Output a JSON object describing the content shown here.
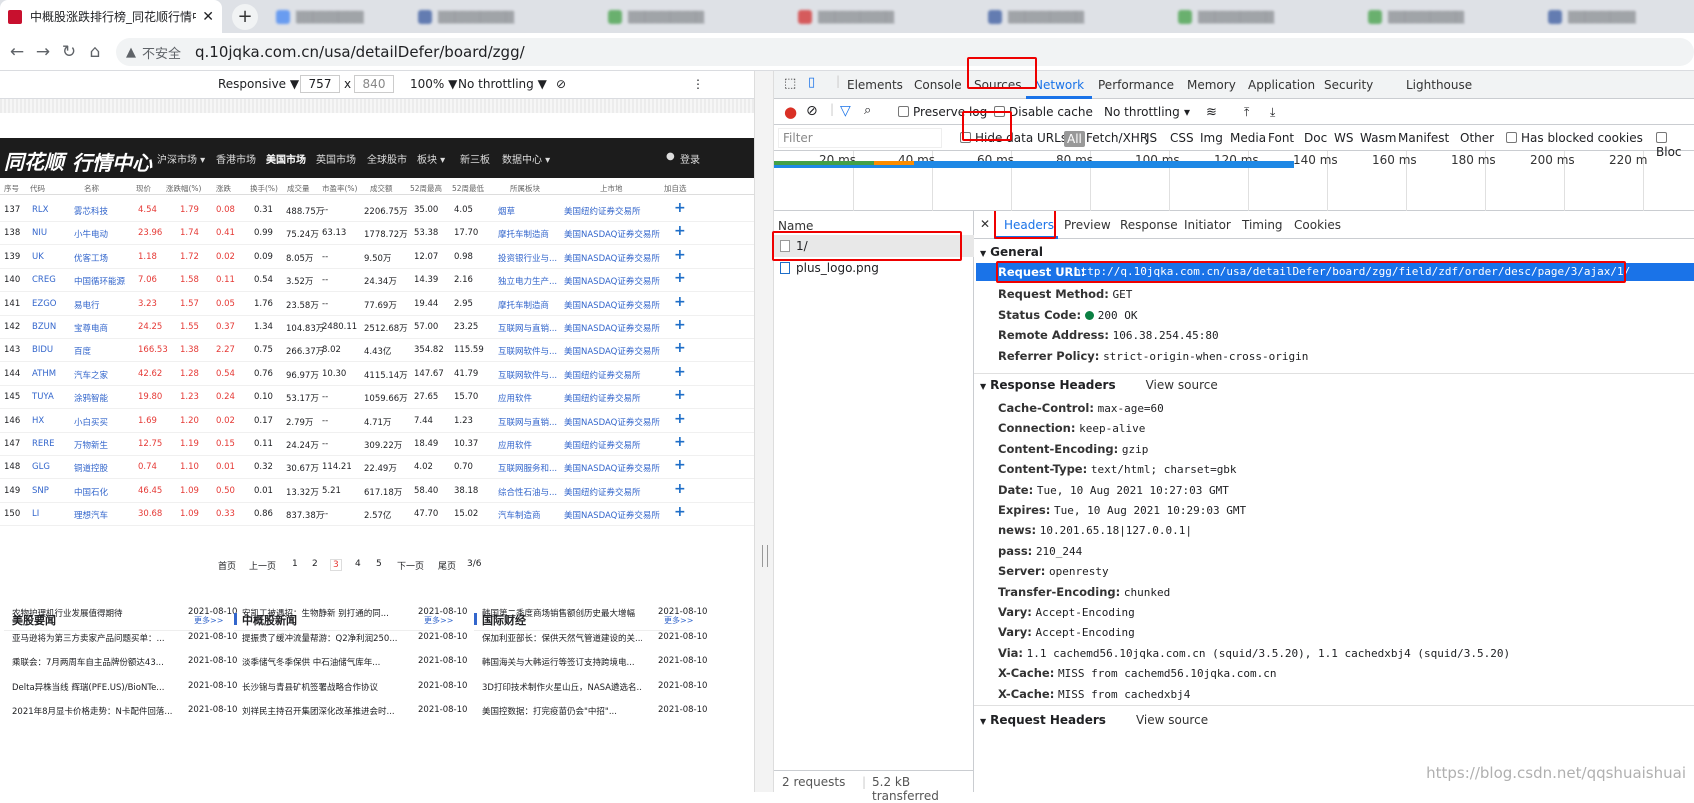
{
  "browser": {
    "active_tab_title": "中概股涨跌排行榜_同花顺行情中",
    "address_insecure": "不安全",
    "url": "q.10jqka.com.cn/usa/detailDefer/board/zgg/"
  },
  "device_toolbar": {
    "mode": "Responsive ▼",
    "width": "757",
    "times": "x",
    "height": "840",
    "zoom": "100% ▼",
    "throttle": "No throttling ▼"
  },
  "site": {
    "logo": "同花顺",
    "logo_sub": "行情中心",
    "nav": [
      "沪深市场 ▾",
      "香港市场",
      "美国市场",
      "英国市场",
      "全球股市",
      "板块 ▾",
      "新三板",
      "数据中心 ▾"
    ],
    "login": "登录",
    "columns": [
      "序号",
      "代码",
      "名称",
      "现价",
      "涨跌幅(%)",
      "涨跌",
      "换手(%)",
      "成交量",
      "市盈率(%)",
      "成交额",
      "52周最高",
      "52周最低",
      "所属板块",
      "上市地",
      "加自选"
    ],
    "rows": [
      [
        "137",
        "RLX",
        "雾芯科技",
        "4.54",
        "1.79",
        "0.08",
        "0.31",
        "488.75万",
        "--",
        "2206.75万",
        "35.00",
        "4.05",
        "烟草",
        "美国纽约证券交易所"
      ],
      [
        "138",
        "NIU",
        "小牛电动",
        "23.96",
        "1.74",
        "0.41",
        "0.99",
        "75.24万",
        "63.13",
        "1778.72万",
        "53.38",
        "17.70",
        "摩托车制造商",
        "美国NASDAQ证券交易所"
      ],
      [
        "139",
        "UK",
        "优客工场",
        "1.18",
        "1.72",
        "0.02",
        "0.09",
        "8.05万",
        "--",
        "9.50万",
        "12.07",
        "0.98",
        "投资银行业与...",
        "美国NASDAQ证券交易所"
      ],
      [
        "140",
        "CREG",
        "中国循环能源",
        "7.06",
        "1.58",
        "0.11",
        "0.54",
        "3.52万",
        "--",
        "24.34万",
        "14.39",
        "2.16",
        "独立电力生产...",
        "美国NASDAQ证券交易所"
      ],
      [
        "141",
        "EZGO",
        "易电行",
        "3.23",
        "1.57",
        "0.05",
        "1.76",
        "23.58万",
        "--",
        "77.69万",
        "19.44",
        "2.95",
        "摩托车制造商",
        "美国NASDAQ证券交易所"
      ],
      [
        "142",
        "BZUN",
        "宝尊电商",
        "24.25",
        "1.55",
        "0.37",
        "1.34",
        "104.83万",
        "2480.11",
        "2512.68万",
        "57.00",
        "23.25",
        "互联网与直销...",
        "美国NASDAQ证券交易所"
      ],
      [
        "143",
        "BIDU",
        "百度",
        "166.53",
        "1.38",
        "2.27",
        "0.75",
        "266.37万",
        "8.02",
        "4.43亿",
        "354.82",
        "115.59",
        "互联网软件与...",
        "美国NASDAQ证券交易所"
      ],
      [
        "144",
        "ATHM",
        "汽车之家",
        "42.62",
        "1.28",
        "0.54",
        "0.76",
        "96.97万",
        "10.30",
        "4115.14万",
        "147.67",
        "41.79",
        "互联网软件与...",
        "美国纽约证券交易所"
      ],
      [
        "145",
        "TUYA",
        "涂鸦智能",
        "19.80",
        "1.23",
        "0.24",
        "0.10",
        "53.17万",
        "--",
        "1059.66万",
        "27.65",
        "15.70",
        "应用软件",
        "美国纽约证券交易所"
      ],
      [
        "146",
        "HX",
        "小白买买",
        "1.69",
        "1.20",
        "0.02",
        "0.17",
        "2.79万",
        "--",
        "4.71万",
        "7.44",
        "1.23",
        "互联网与直销...",
        "美国NASDAQ证券交易所"
      ],
      [
        "147",
        "RERE",
        "万物新生",
        "12.75",
        "1.19",
        "0.15",
        "0.11",
        "24.24万",
        "--",
        "309.22万",
        "18.49",
        "10.37",
        "应用软件",
        "美国纽约证券交易所"
      ],
      [
        "148",
        "GLG",
        "铜道控股",
        "0.74",
        "1.10",
        "0.01",
        "0.32",
        "30.67万",
        "114.21",
        "22.49万",
        "4.02",
        "0.70",
        "互联网服务和...",
        "美国NASDAQ证券交易所"
      ],
      [
        "149",
        "SNP",
        "中国石化",
        "46.45",
        "1.09",
        "0.50",
        "0.01",
        "13.32万",
        "5.21",
        "617.18万",
        "58.40",
        "38.18",
        "综合性石油与...",
        "美国纽约证券交易所"
      ],
      [
        "150",
        "LI",
        "理想汽车",
        "30.68",
        "1.09",
        "0.33",
        "0.86",
        "837.38万",
        "--",
        "2.57亿",
        "47.70",
        "15.02",
        "汽车制造商",
        "美国NASDAQ证券交易所"
      ]
    ],
    "pager": [
      "首页",
      "上一页",
      "1",
      "2",
      "3",
      "4",
      "5",
      "下一页",
      "尾页",
      "3/6"
    ],
    "news": [
      {
        "title": "美股要闻",
        "more": "更多>>",
        "items": [
          [
            "农物护理机行业发展值得期待",
            "2021-08-10"
          ],
          [
            "亚马逊将为第三方卖家产品问题买单：...",
            "2021-08-10"
          ],
          [
            "乘联会：7月两周车自主品牌份额达43...",
            "2021-08-10"
          ],
          [
            "Delta异株当线 辉瑞(PFE.US)/BioNTe...",
            "2021-08-10"
          ],
          [
            "2021年8月显卡价格走势：N卡配件回落...",
            "2021-08-10"
          ]
        ]
      },
      {
        "title": "中概股新闻",
        "more": "更多>>",
        "items": [
          [
            "安凯工被遇招：生物静新 别打通的同...",
            "2021-08-10"
          ],
          [
            "提振贵了缓冲流量帮游：Q2净利润250...",
            "2021-08-10"
          ],
          [
            "淡季储气冬季保供 中石油储气库年...",
            "2021-08-10"
          ],
          [
            "长沙锦与青县矿机签署战略合作协议",
            "2021-08-10"
          ],
          [
            "刘祥民主持召开集团深化改革推进会时...",
            "2021-08-10"
          ]
        ]
      },
      {
        "title": "国际财经",
        "more": "更多>>",
        "items": [
          [
            "韩国第二季度商场销售额创历史最大增幅",
            "2021-08-10"
          ],
          [
            "保加利亚部长：保供天然气管道建设的关...",
            "2021-08-10"
          ],
          [
            "韩国海关与大韩运行等签订支持跨境电...",
            "2021-08-10"
          ],
          [
            "3D打印技术制作火星山丘，NASA遴选名...",
            "2021-08-10"
          ],
          [
            "美国控数据：打完疫苗仍会\"中招\"...",
            "2021-08-10"
          ]
        ]
      }
    ]
  },
  "devtools": {
    "tabs": [
      "Elements",
      "Console",
      "Sources",
      "Network",
      "Performance",
      "Memory",
      "Application",
      "Security",
      "Lighthouse"
    ],
    "active_tab": "Network",
    "toolbar": {
      "preserve_log": "Preserve log",
      "disable_cache": "Disable cache",
      "throttling": "No throttling"
    },
    "filter": {
      "placeholder": "Filter",
      "hide_data_urls": "Hide data URLs",
      "types": [
        "All",
        "Fetch/XHR",
        "JS",
        "CSS",
        "Img",
        "Media",
        "Font",
        "Doc",
        "WS",
        "Wasm",
        "Manifest",
        "Other"
      ],
      "has_blocked": "Has blocked cookies",
      "blocked_requests": "Bloc"
    },
    "timeline_ticks": [
      "20 ms",
      "40 ms",
      "60 ms",
      "80 ms",
      "100 ms",
      "120 ms",
      "140 ms",
      "160 ms",
      "180 ms",
      "200 ms",
      "220 m"
    ],
    "requests_header": "Name",
    "requests": [
      "1/",
      "plus_logo.png"
    ],
    "footer": {
      "count": "2 requests",
      "transferred": "5.2 kB transferred"
    },
    "detail_tabs": [
      "Headers",
      "Preview",
      "Response",
      "Initiator",
      "Timing",
      "Cookies"
    ],
    "general": {
      "title": "General",
      "request_url_k": "Request URL:",
      "request_url": "http://q.10jqka.com.cn/usa/detailDefer/board/zgg/field/zdf/order/desc/page/3/ajax/1/",
      "rows": [
        [
          "Request Method:",
          "GET"
        ],
        [
          "Status Code:",
          "200 OK"
        ],
        [
          "Remote Address:",
          "106.38.254.45:80"
        ],
        [
          "Referrer Policy:",
          "strict-origin-when-cross-origin"
        ]
      ]
    },
    "response_headers": {
      "title": "Response Headers",
      "view_source": "View source",
      "rows": [
        [
          "Cache-Control:",
          "max-age=60"
        ],
        [
          "Connection:",
          "keep-alive"
        ],
        [
          "Content-Encoding:",
          "gzip"
        ],
        [
          "Content-Type:",
          "text/html; charset=gbk"
        ],
        [
          "Date:",
          "Tue, 10 Aug 2021 10:27:03 GMT"
        ],
        [
          "Expires:",
          "Tue, 10 Aug 2021 10:29:03 GMT"
        ],
        [
          "news:",
          "10.201.65.18|127.0.0.1|"
        ],
        [
          "pass:",
          "210_244"
        ],
        [
          "Server:",
          "openresty"
        ],
        [
          "Transfer-Encoding:",
          "chunked"
        ],
        [
          "Vary:",
          "Accept-Encoding"
        ],
        [
          "Vary:",
          "Accept-Encoding"
        ],
        [
          "Via:",
          "1.1 cachemd56.10jqka.com.cn (squid/3.5.20), 1.1 cachedxbj4 (squid/3.5.20)"
        ],
        [
          "X-Cache:",
          "MISS from cachemd56.10jqka.com.cn"
        ],
        [
          "X-Cache:",
          "MISS from cachedxbj4"
        ]
      ]
    },
    "request_headers": {
      "title": "Request Headers",
      "view_source": "View source"
    }
  },
  "watermark": "https://blog.csdn.net/qqshuaishuai",
  "colors": {
    "accent": "#1a73e8",
    "highlight_box": "#e00000",
    "price_red": "#e53935",
    "link_blue": "#3366cc"
  }
}
